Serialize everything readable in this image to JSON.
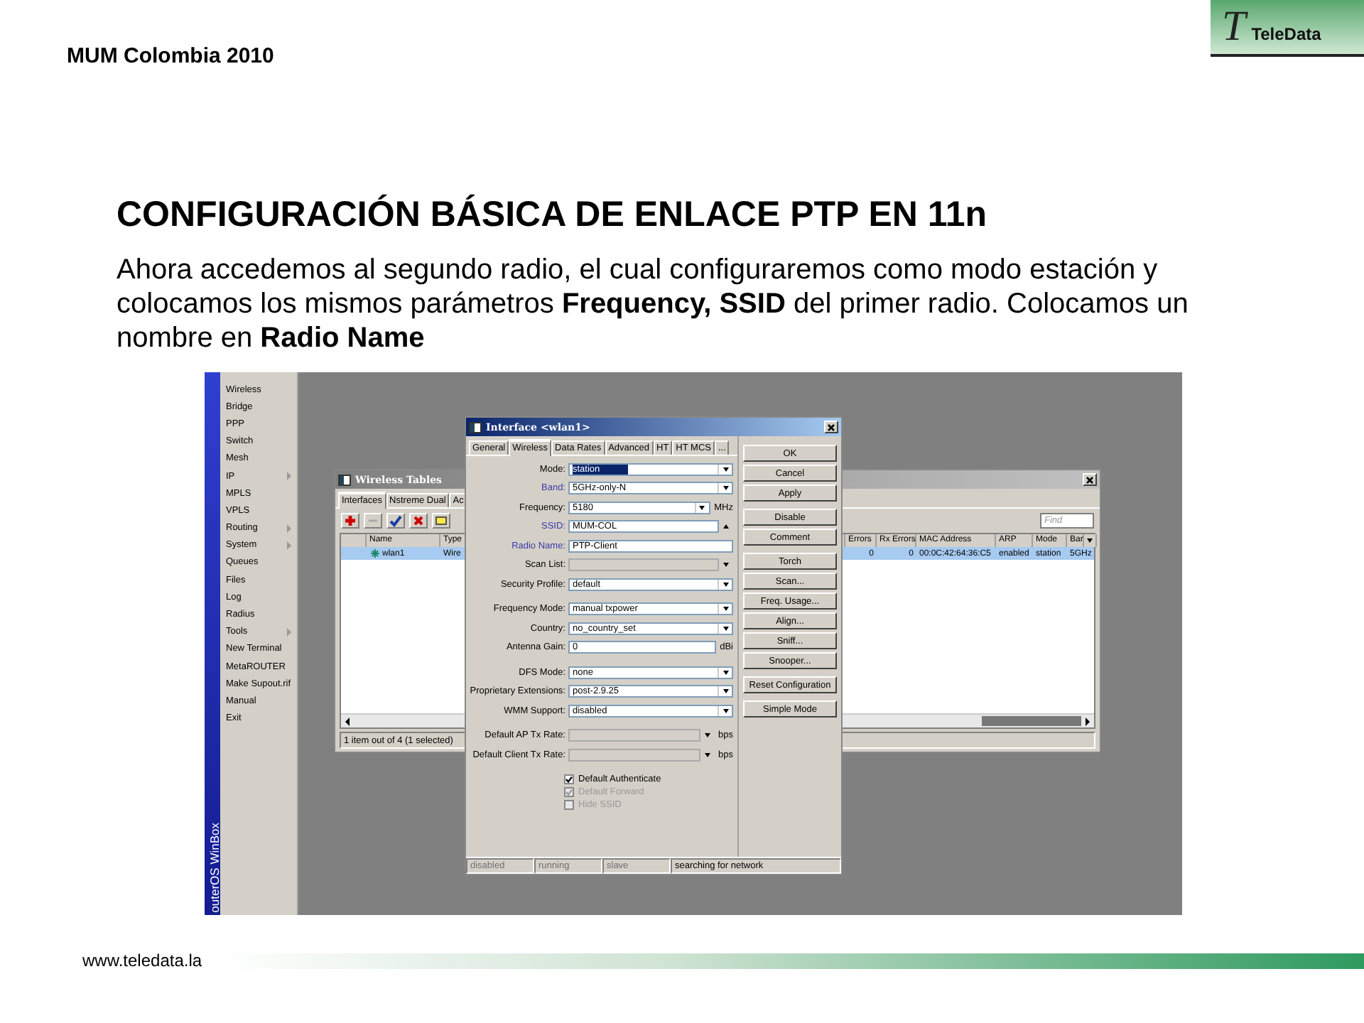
{
  "header": {
    "event": "MUM Colombia 2010",
    "logo": {
      "mark": "T",
      "name": "TeleData"
    }
  },
  "title": "CONFIGURACIÓN BÁSICA DE ENLACE PTP EN 11n",
  "paragraph": "Ahora accedemos al segundo radio, el cual configuraremos como modo estación y colocamos los mismos parámetros **Frequency, SSID** del primer radio. Colocamos un nombre en **Radio Name**",
  "winbox": {
    "side_label": "outerOS WinBox",
    "menu": [
      {
        "label": "Wireless",
        "submenu": false
      },
      {
        "label": "Bridge",
        "submenu": false
      },
      {
        "label": "PPP",
        "submenu": false
      },
      {
        "label": "Switch",
        "submenu": false
      },
      {
        "label": "Mesh",
        "submenu": false
      },
      {
        "label": "IP",
        "submenu": true
      },
      {
        "label": "MPLS",
        "submenu": false
      },
      {
        "label": "VPLS",
        "submenu": false
      },
      {
        "label": "Routing",
        "submenu": true
      },
      {
        "label": "System",
        "submenu": true
      },
      {
        "label": "Queues",
        "submenu": false
      },
      {
        "label": "Files",
        "submenu": false
      },
      {
        "label": "Log",
        "submenu": false
      },
      {
        "label": "Radius",
        "submenu": false
      },
      {
        "label": "Tools",
        "submenu": true
      },
      {
        "label": "New Terminal",
        "submenu": false
      },
      {
        "label": "MetaROUTER",
        "submenu": false
      },
      {
        "label": "Make Supout.rif",
        "submenu": false
      },
      {
        "label": "Manual",
        "submenu": false
      },
      {
        "label": "Exit",
        "submenu": false
      }
    ],
    "wireless_tables": {
      "title": "Wireless Tables",
      "tabs": [
        {
          "label": "Interfaces",
          "selected": true
        },
        {
          "label": "Nstreme Dual",
          "selected": false
        },
        {
          "label": "Ac",
          "selected": false
        }
      ],
      "find": {
        "placeholder": "Find"
      },
      "columns": [
        "Name",
        "Type",
        "Errors",
        "Rx Errors",
        "MAC Address",
        "ARP",
        "Mode",
        "Bar"
      ],
      "rows": [
        {
          "selected": true,
          "cells": [
            "wlan1",
            "Wire",
            "0",
            "0",
            "00:0C:42:64:36:C5",
            "enabled",
            "station",
            "5GHz"
          ]
        }
      ],
      "status": "1 item out of 4 (1 selected)"
    },
    "interface_dialog": {
      "title": "Interface <wlan1>",
      "tabs": [
        {
          "label": "General",
          "selected": false
        },
        {
          "label": "Wireless",
          "selected": true
        },
        {
          "label": "Data Rates",
          "selected": false
        },
        {
          "label": "Advanced",
          "selected": false
        },
        {
          "label": "HT",
          "selected": false
        },
        {
          "label": "HT MCS",
          "selected": false
        },
        {
          "label": "...",
          "selected": false
        }
      ],
      "field_groups": [
        {
          "fields": [
            {
              "label": "Mode:",
              "kind": "select",
              "value": "station",
              "emphasized": false,
              "disabled": false,
              "highlighted": true
            },
            {
              "label": "Band:",
              "kind": "select",
              "value": "5GHz-only-N",
              "emphasized": true,
              "disabled": false,
              "highlighted": false
            },
            {
              "label": "Frequency:",
              "kind": "select",
              "value": "5180",
              "unit": "MHz",
              "emphasized": false,
              "disabled": false,
              "highlighted": false
            },
            {
              "label": "SSID:",
              "kind": "expander",
              "value": "MUM-COL",
              "emphasized": true,
              "disabled": false,
              "highlighted": false
            },
            {
              "label": "Radio Name:",
              "kind": "text",
              "value": "PTP-Client",
              "emphasized": true,
              "disabled": false,
              "highlighted": false
            },
            {
              "label": "Scan List:",
              "kind": "list",
              "emphasized": false,
              "disabled": true,
              "highlighted": false
            },
            {
              "label": "Security Profile:",
              "kind": "select",
              "value": "default",
              "emphasized": false,
              "disabled": false,
              "highlighted": false
            }
          ]
        },
        {
          "fields": [
            {
              "label": "Frequency Mode:",
              "kind": "select",
              "value": "manual txpower",
              "emphasized": false,
              "disabled": false,
              "highlighted": false
            },
            {
              "label": "Country:",
              "kind": "select",
              "value": "no_country_set",
              "emphasized": false,
              "disabled": false,
              "highlighted": false
            },
            {
              "label": "Antenna Gain:",
              "kind": "text",
              "value": "0",
              "unit": "dBi",
              "emphasized": false,
              "disabled": false,
              "highlighted": false
            }
          ]
        },
        {
          "fields": [
            {
              "label": "DFS Mode:",
              "kind": "select",
              "value": "none",
              "emphasized": false,
              "disabled": false,
              "highlighted": false
            },
            {
              "label": "Proprietary Extensions:",
              "kind": "select",
              "value": "post-2.9.25",
              "emphasized": false,
              "disabled": false,
              "highlighted": false
            },
            {
              "label": "WMM Support:",
              "kind": "select",
              "value": "disabled",
              "emphasized": false,
              "disabled": false,
              "highlighted": false
            }
          ]
        },
        {
          "fields": [
            {
              "label": "Default AP Tx Rate:",
              "kind": "list",
              "unit": "bps",
              "emphasized": false,
              "disabled": true,
              "highlighted": false
            },
            {
              "label": "Default Client Tx Rate:",
              "kind": "list",
              "unit": "bps",
              "emphasized": false,
              "disabled": true,
              "highlighted": false
            }
          ]
        }
      ],
      "checkboxes": [
        {
          "label": "Default Authenticate",
          "checked": true,
          "disabled": false
        },
        {
          "label": "Default Forward",
          "checked": true,
          "disabled": true
        },
        {
          "label": "Hide SSID",
          "checked": false,
          "disabled": true
        }
      ],
      "button_groups": [
        [
          "OK",
          "Cancel",
          "Apply"
        ],
        [
          "Disable",
          "Comment"
        ],
        [
          "Torch",
          "Scan...",
          "Freq. Usage...",
          "Align...",
          "Sniff...",
          "Snooper..."
        ],
        [
          "Reset Configuration"
        ],
        [
          "Simple Mode"
        ]
      ],
      "status_bar": [
        {
          "text": "disabled",
          "active": false
        },
        {
          "text": "running",
          "active": false
        },
        {
          "text": "slave",
          "active": false
        },
        {
          "text": "searching for network",
          "active": true
        }
      ]
    }
  },
  "footer": {
    "url": "www.teledata.la"
  }
}
